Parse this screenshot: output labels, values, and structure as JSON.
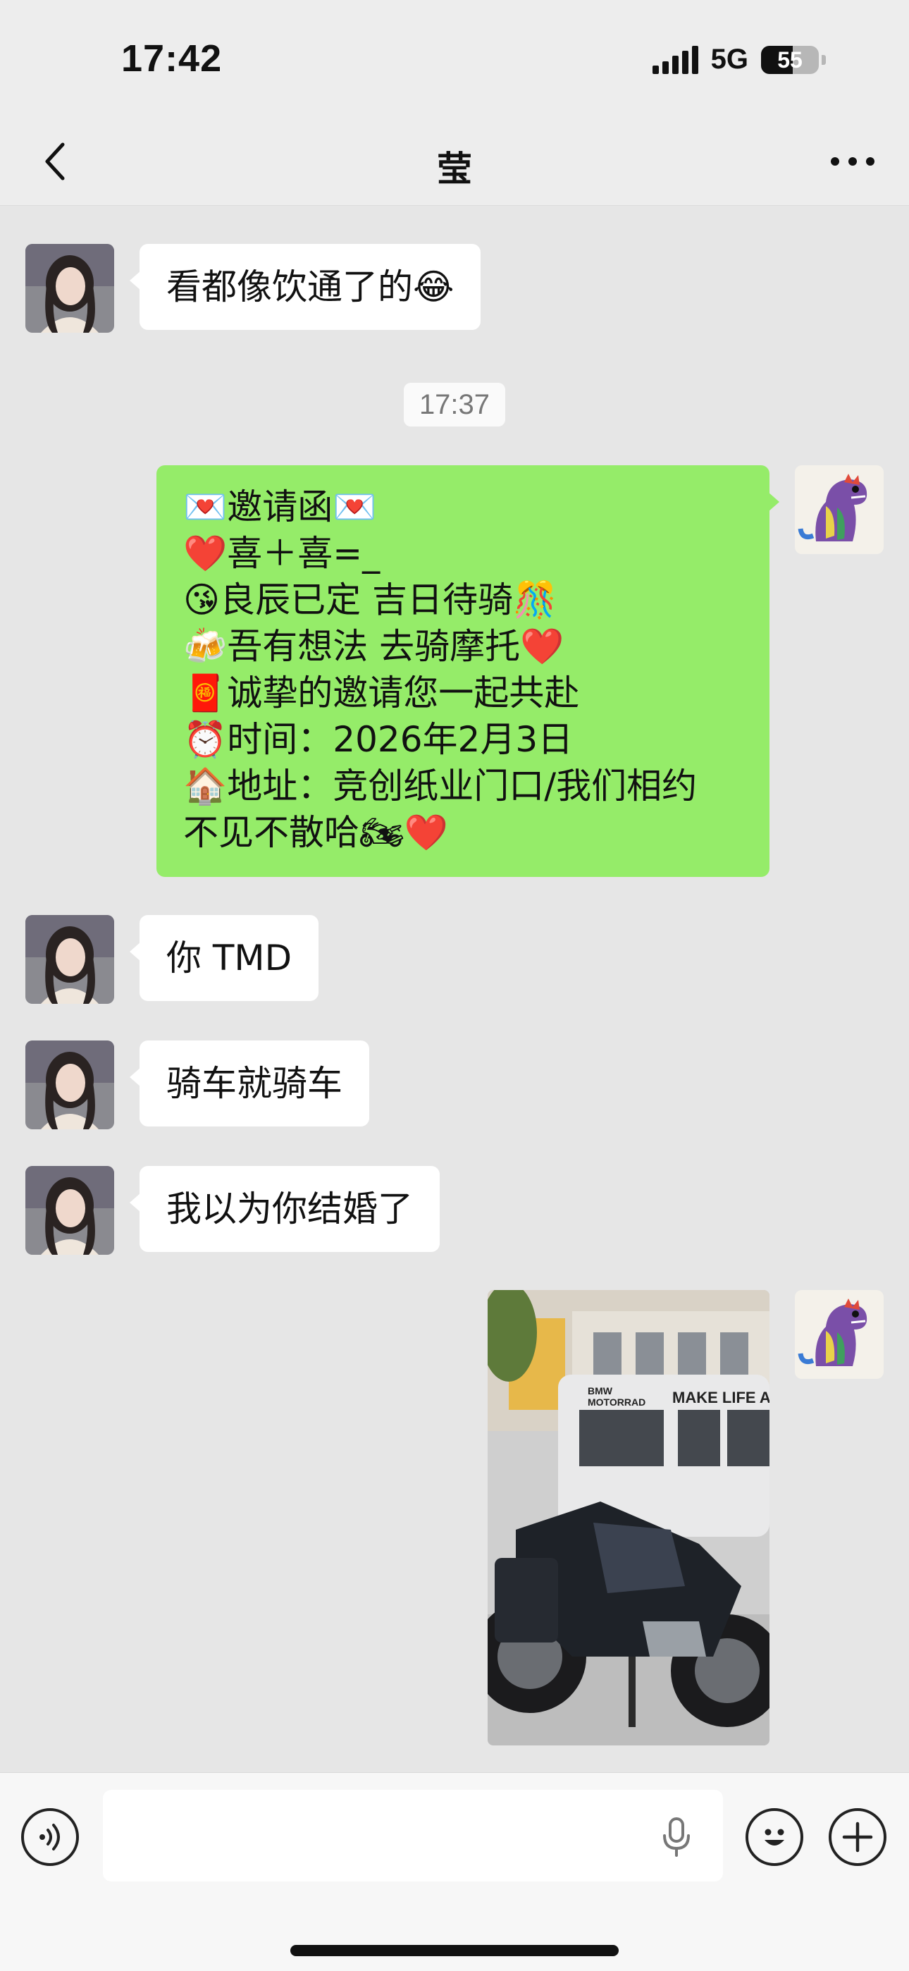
{
  "status_bar": {
    "time": "17:42",
    "network": "5G",
    "battery_percent": 55,
    "battery_label": "55",
    "icons": [
      "signal-icon",
      "battery-icon"
    ]
  },
  "nav": {
    "title": "莹",
    "back_icon": "chevron-left-icon",
    "more_icon": "more-dots-icon"
  },
  "messages": [
    {
      "side": "left",
      "text": "看都像饮通了的😂"
    },
    {
      "type": "timestamp",
      "text": "17:37"
    },
    {
      "side": "right",
      "lines": [
        "💌邀请函💌",
        "❤️喜＋喜=_",
        "😘良辰已定 吉日待骑🎊",
        "🍻吾有想法 去骑摩托❤️",
        "🧧诚挚的邀请您一起共赴",
        "⏰时间：2026年2月3日",
        "🏠地址：竞创纸业门口/我们相约",
        "不见不散哈🏍❤️"
      ]
    },
    {
      "side": "left",
      "text": "你 TMD"
    },
    {
      "side": "left",
      "text": "骑车就骑车"
    },
    {
      "side": "left",
      "text": "我以为你结婚了"
    },
    {
      "side": "right",
      "type": "image",
      "image_texts": [
        "BMW",
        "MOTORRAD",
        "MAKE LIFE A"
      ]
    }
  ],
  "input_bar": {
    "voice_icon": "voice-icon",
    "input_value": "",
    "mic_icon": "microphone-icon",
    "emoji_icon": "emoji-icon",
    "add_icon": "plus-icon"
  },
  "colors": {
    "chat_bg": "#e6e6e6",
    "bubble_self": "#95ec69",
    "bubble_other": "#ffffff",
    "bar_bg": "#ededed"
  }
}
